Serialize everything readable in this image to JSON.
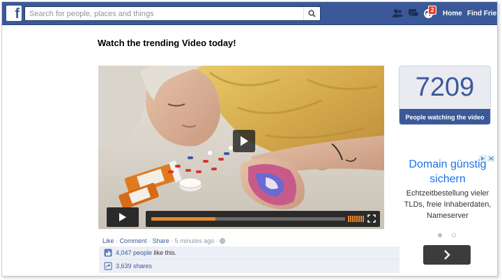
{
  "topbar": {
    "logo_letter": "f",
    "search_placeholder": "Search for people, places and things",
    "notifications_count": "2",
    "nav_home": "Home",
    "nav_find_friends": "Find Frien"
  },
  "post": {
    "headline": "Watch the trending Video today!",
    "video_progress_percent": 33,
    "actions": {
      "like": "Like",
      "comment": "Comment",
      "share": "Share",
      "separator": "·",
      "time": "5 minutes ago"
    },
    "likes_count": "4,047 people",
    "likes_suffix": "like this.",
    "shares": "3,639 shares"
  },
  "counter": {
    "number": "7209",
    "label": "People watching the video"
  },
  "ad": {
    "title": "Domain günstig sichern",
    "body": "Echtzeitbestellung vieler TLDs, freie Inhaberdaten, Nameserver"
  },
  "colors": {
    "facebook_blue": "#3b5998",
    "progress_orange": "#e8882a",
    "ad_link_blue": "#1a73e8"
  }
}
